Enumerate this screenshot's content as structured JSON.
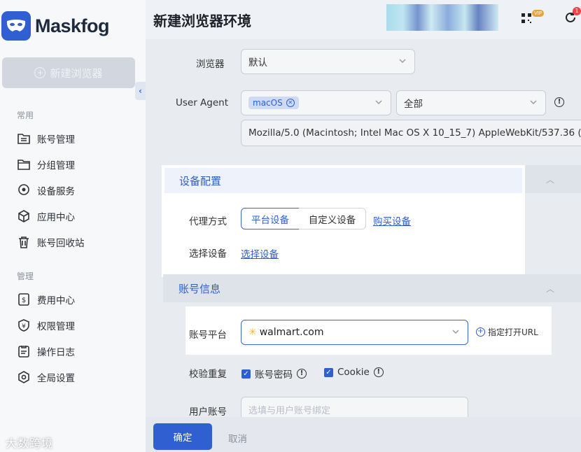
{
  "app": {
    "name": "Maskfog"
  },
  "sidebar": {
    "new_browser_label": "新建浏览器",
    "sections": [
      {
        "title": "常用",
        "items": [
          {
            "label": "账号管理",
            "icon": "folder-list-icon"
          },
          {
            "label": "分组管理",
            "icon": "folder-icon"
          },
          {
            "label": "设备服务",
            "icon": "location-pin-icon"
          },
          {
            "label": "应用中心",
            "icon": "cube-icon"
          },
          {
            "label": "账号回收站",
            "icon": "trash-icon"
          }
        ]
      },
      {
        "title": "管理",
        "items": [
          {
            "label": "费用中心",
            "icon": "dollar-doc-icon"
          },
          {
            "label": "权限管理",
            "icon": "shield-yen-icon"
          },
          {
            "label": "操作日志",
            "icon": "log-icon"
          },
          {
            "label": "全局设置",
            "icon": "settings-hex-icon"
          }
        ]
      }
    ],
    "watermark": "大数跨境"
  },
  "header": {
    "title": "新建浏览器环境",
    "vip_badge": "VIP",
    "notification_count": "1"
  },
  "form": {
    "browser": {
      "label": "浏览器",
      "value": "默认"
    },
    "user_agent": {
      "label": "User Agent",
      "os_tag": "macOS",
      "version_value": "全部",
      "string": "Mozilla/5.0 (Macintosh; Intel Mac OS X 10_15_7) AppleWebKit/537.36 ("
    },
    "device_section": {
      "title": "设备配置",
      "proxy_label": "代理方式",
      "proxy_options": [
        "平台设备",
        "自定义设备"
      ],
      "proxy_selected": "平台设备",
      "buy_link": "购买设备",
      "select_label": "选择设备",
      "select_link": "选择设备"
    },
    "account_section": {
      "title": "账号信息",
      "platform_label": "账号平台",
      "platform_value": "walmart.com",
      "open_url_label": "指定打开URL",
      "dup_check_label": "校验重复",
      "dup_options": [
        {
          "label": "账号密码",
          "checked": true
        },
        {
          "label": "Cookie",
          "checked": true
        }
      ],
      "user_account_label": "用户账号",
      "user_account_placeholder": "选填与用户账号绑定"
    }
  },
  "footer": {
    "confirm_label": "确定",
    "cancel_label": "取消"
  },
  "colors": {
    "accent": "#2f5fd0",
    "badge": "#e9a23b",
    "notif": "#ee4444"
  }
}
